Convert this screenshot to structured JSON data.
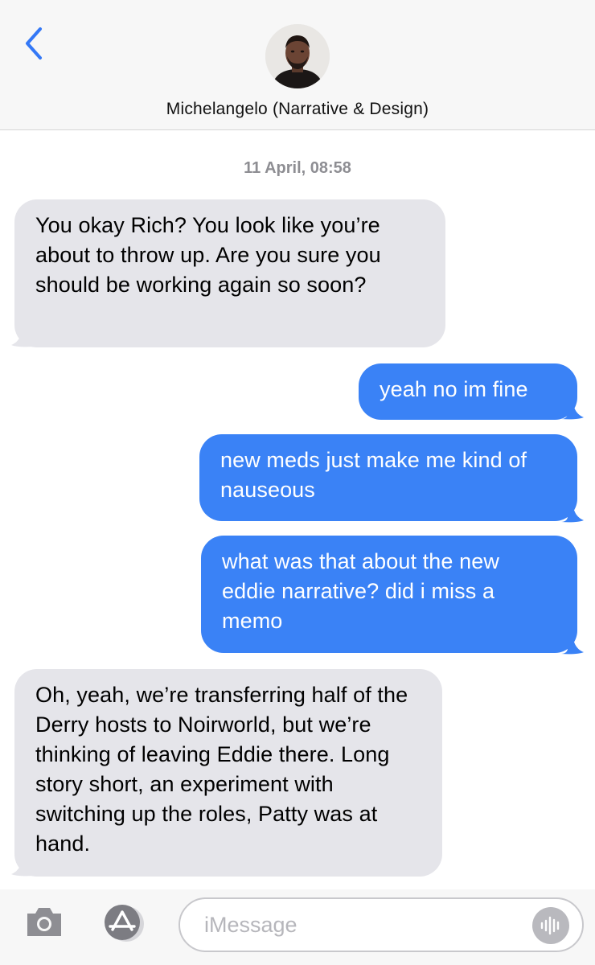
{
  "header": {
    "contact_name": "Michelangelo (Narrative & Design)",
    "back_icon": "chevron-left-icon",
    "avatar": "contact-avatar"
  },
  "conversation": {
    "timestamp": "11 April, 08:58",
    "messages": [
      {
        "direction": "incoming",
        "text": "You okay Rich? You look like you’re about to throw up. Are you sure you should be working again so soon?"
      },
      {
        "direction": "outgoing",
        "text": "yeah no im fine"
      },
      {
        "direction": "outgoing",
        "text": "new meds just make me kind of nauseous"
      },
      {
        "direction": "outgoing",
        "text": "what was that about the new eddie narrative? did i miss a memo"
      },
      {
        "direction": "incoming",
        "text": "Oh, yeah, we’re transferring half of the Derry hosts to Noirworld, but we’re thinking of leaving Eddie there. Long story short, an experiment with switching up the roles, Patty was at hand."
      }
    ]
  },
  "input_bar": {
    "placeholder": "iMessage",
    "camera_icon": "camera-icon",
    "apps_icon": "app-store-icon",
    "audio_icon": "audio-waveform-icon"
  },
  "colors": {
    "outgoing_bubble": "#3a82f6",
    "incoming_bubble": "#e5e5ea",
    "accent": "#3478f6",
    "header_bg": "#f7f7f7"
  }
}
